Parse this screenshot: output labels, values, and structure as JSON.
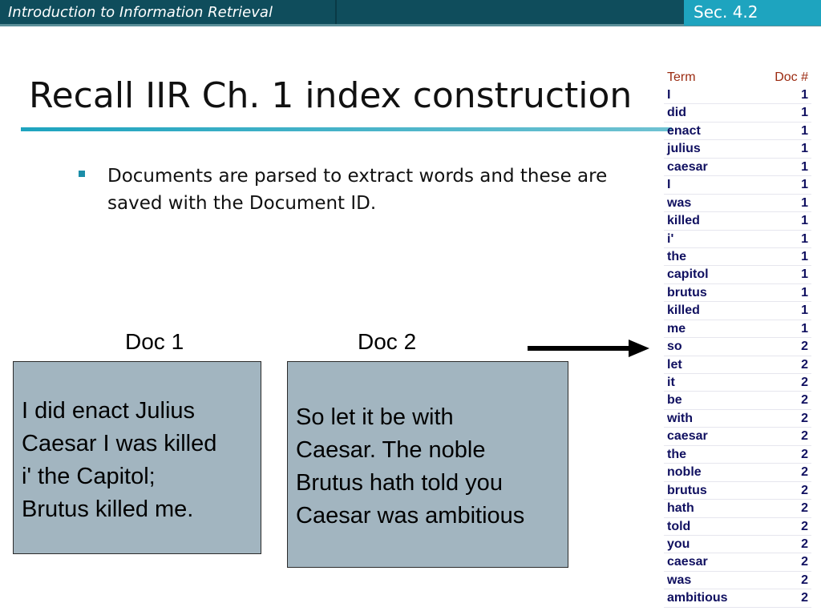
{
  "header": {
    "course_title": "Introduction to Information Retrieval",
    "section": "Sec. 4.2"
  },
  "slide": {
    "title": "Recall IIR Ch. 1 index construction",
    "bullet": "Documents are parsed to extract words and these are saved with the Document ID."
  },
  "docs": [
    {
      "label": "Doc 1",
      "lines": [
        "I did enact Julius",
        "Caesar I was killed",
        "i' the Capitol;",
        "Brutus killed me."
      ]
    },
    {
      "label": "Doc 2",
      "lines": [
        "So let it be with",
        "Caesar. The noble",
        "Brutus hath told you",
        "Caesar was ambitious"
      ]
    }
  ],
  "index": {
    "header": {
      "term": "Term",
      "doc": "Doc #"
    },
    "rows": [
      {
        "term": "I",
        "doc": "1"
      },
      {
        "term": "did",
        "doc": "1"
      },
      {
        "term": "enact",
        "doc": "1"
      },
      {
        "term": "julius",
        "doc": "1"
      },
      {
        "term": "caesar",
        "doc": "1"
      },
      {
        "term": "I",
        "doc": "1"
      },
      {
        "term": "was",
        "doc": "1"
      },
      {
        "term": "killed",
        "doc": "1"
      },
      {
        "term": "i'",
        "doc": "1"
      },
      {
        "term": "the",
        "doc": "1"
      },
      {
        "term": "capitol",
        "doc": "1"
      },
      {
        "term": "brutus",
        "doc": "1"
      },
      {
        "term": "killed",
        "doc": "1"
      },
      {
        "term": "me",
        "doc": "1"
      },
      {
        "term": "so",
        "doc": "2"
      },
      {
        "term": "let",
        "doc": "2"
      },
      {
        "term": "it",
        "doc": "2"
      },
      {
        "term": "be",
        "doc": "2"
      },
      {
        "term": "with",
        "doc": "2"
      },
      {
        "term": "caesar",
        "doc": "2"
      },
      {
        "term": "the",
        "doc": "2"
      },
      {
        "term": "noble",
        "doc": "2"
      },
      {
        "term": "brutus",
        "doc": "2"
      },
      {
        "term": "hath",
        "doc": "2"
      },
      {
        "term": "told",
        "doc": "2"
      },
      {
        "term": "you",
        "doc": "2"
      },
      {
        "term": "caesar",
        "doc": "2"
      },
      {
        "term": "was",
        "doc": "2"
      },
      {
        "term": "ambitious",
        "doc": "2"
      }
    ]
  }
}
